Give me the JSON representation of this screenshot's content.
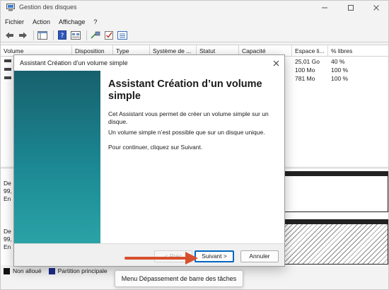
{
  "window": {
    "title": "Gestion des disques"
  },
  "menubar": {
    "items": [
      "Fichier",
      "Action",
      "Affichage",
      "?"
    ]
  },
  "volume_list": {
    "columns": [
      "Volume",
      "Disposition",
      "Type",
      "Système de ...",
      "Statut",
      "Capacité",
      "Espace li...",
      "% libres"
    ],
    "rows": [
      {
        "free_space": "25,01 Go",
        "percent_free": "40 %"
      },
      {
        "free_space": "100 Mo",
        "percent_free": "100 %"
      },
      {
        "free_space": "781 Mo",
        "percent_free": "100 %"
      }
    ]
  },
  "disk_area": {
    "disks": [
      {
        "line1": "De",
        "line2": "99,",
        "line3": "En"
      },
      {
        "line1": "De",
        "line2": "99,",
        "line3": "En"
      }
    ]
  },
  "legend": [
    {
      "label": "Non alloué",
      "color": "#111111"
    },
    {
      "label": "Partition principale",
      "color": "#1c2c8c"
    }
  ],
  "overflow_tooltip": "Menu Dépassement de barre des tâches",
  "dialog": {
    "title": "Assistant Création d’un volume simple",
    "heading": "Assistant Création d’un volume simple",
    "paragraphs": [
      "Cet Assistant vous permet de créer un volume simple sur un disque.",
      "Un volume simple n’est possible que sur un disque unique.",
      "Pour continuer, cliquez sur Suivant."
    ],
    "buttons": {
      "back": "< Préc",
      "next": "Suivant >",
      "cancel": "Annuler"
    }
  },
  "colors": {
    "accent": "#0067c0",
    "wizard_panel": "#1b8893",
    "annotation_arrow": "#d6502e"
  }
}
